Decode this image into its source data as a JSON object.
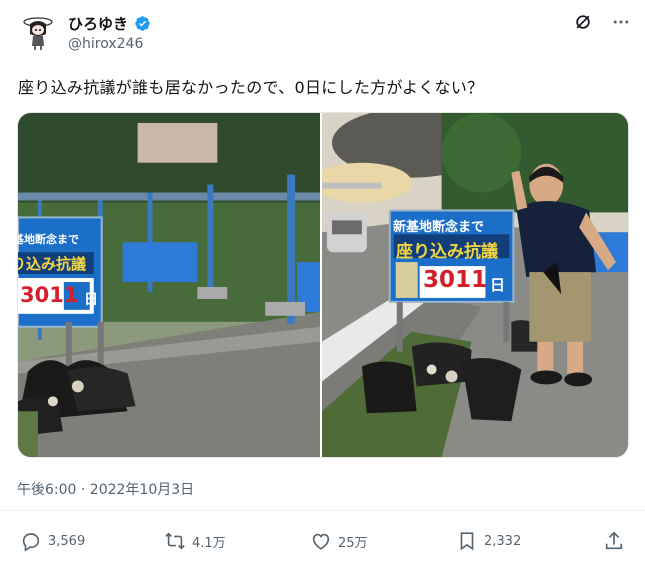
{
  "user": {
    "display_name": "ひろゆき",
    "handle": "@hirox246",
    "verified_badge_color": "#1d9bf0"
  },
  "tweet": {
    "text": "座り込み抗議が誰も居なかったので、0日にした方がよくない？",
    "timestamp": "午後6:00 · 2022年10月3日"
  },
  "photos": {
    "left_sign": {
      "line1": "新基地断念まで",
      "line2": "座り込み抗議",
      "days": "3011",
      "unit": "日"
    },
    "right_sign": {
      "line1": "新基地断念まで",
      "line2": "座り込み抗議",
      "days": "3011",
      "unit": "日"
    }
  },
  "actions": {
    "replies": "3,569",
    "retweets": "4.1万",
    "likes": "25万",
    "bookmarks": "2,332"
  },
  "icons": {
    "more": "more-icon",
    "grok": "grok-icon",
    "reply": "reply-icon",
    "retweet": "retweet-icon",
    "like": "heart-icon",
    "bookmark": "bookmark-icon",
    "share": "share-icon"
  }
}
